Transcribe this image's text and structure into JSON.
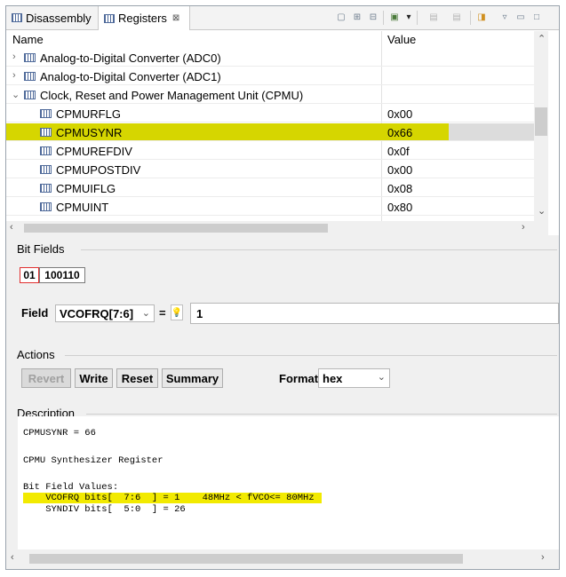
{
  "tabs": [
    {
      "label": "Disassembly",
      "icon": "disassembly-icon"
    },
    {
      "label": "Registers",
      "icon": "registers-icon",
      "close": "⊠"
    }
  ],
  "table": {
    "col_name": "Name",
    "col_value": "Value",
    "rows": [
      {
        "name": "Analog-to-Digital Converter (ADC0)",
        "value": "",
        "level": 0,
        "expanded": false
      },
      {
        "name": "Analog-to-Digital Converter (ADC1)",
        "value": "",
        "level": 0,
        "expanded": false
      },
      {
        "name": "Clock, Reset and Power Management Unit (CPMU)",
        "value": "",
        "level": 0,
        "expanded": true
      },
      {
        "name": "CPMURFLG",
        "value": "0x00",
        "level": 1
      },
      {
        "name": "CPMUSYNR",
        "value": "0x66",
        "level": 1,
        "selected": true
      },
      {
        "name": "CPMUREFDIV",
        "value": "0x0f",
        "level": 1
      },
      {
        "name": "CPMUPOSTDIV",
        "value": "0x00",
        "level": 1
      },
      {
        "name": "CPMUIFLG",
        "value": "0x08",
        "level": 1
      },
      {
        "name": "CPMUINT",
        "value": "0x80",
        "level": 1
      }
    ]
  },
  "bitfields": {
    "title": "Bit Fields",
    "bits_selected": "01",
    "bits_rest": "100110",
    "field_label": "Field",
    "field_value": "VCOFRQ[7:6]",
    "equals": "=",
    "value": "1"
  },
  "actions": {
    "title": "Actions",
    "revert": "Revert",
    "write": "Write",
    "reset": "Reset",
    "summary": "Summary",
    "format_label": "Format",
    "format_value": "hex"
  },
  "description": {
    "title": "Description",
    "lines": [
      "CPMUSYNR = 66",
      "CPMU Synthesizer Register",
      "Bit Field Values:",
      "    VCOFRQ bits[  7:6  ] = 1    48MHz < fVCO<= 80MHz",
      "    SYNDIV bits[  5:0  ] = 26"
    ]
  },
  "colors": {
    "highlight": "#d6d600",
    "selected_bit_border": "#e03030"
  }
}
